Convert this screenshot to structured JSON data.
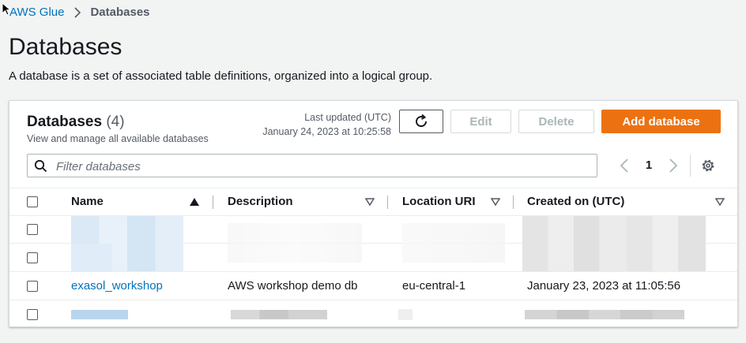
{
  "breadcrumb": {
    "parent": "AWS Glue",
    "current": "Databases"
  },
  "page": {
    "title": "Databases",
    "description": "A database is a set of associated table definitions, organized into a logical group."
  },
  "panel": {
    "title": "Databases",
    "count": "(4)",
    "subtitle": "View and manage all available databases",
    "last_updated_label": "Last updated (UTC)",
    "last_updated_value": "January 24, 2023 at 10:25:58",
    "buttons": {
      "edit": "Edit",
      "delete": "Delete",
      "add": "Add database"
    },
    "filter_placeholder": "Filter databases",
    "pagination": {
      "current_page": "1"
    }
  },
  "table": {
    "columns": [
      "Name",
      "Description",
      "Location URI",
      "Created on (UTC)"
    ],
    "sorted_column": "Name",
    "rows": [
      {
        "name": "",
        "description": "",
        "location": "",
        "created": "",
        "redacted": true
      },
      {
        "name": "",
        "description": "",
        "location": "",
        "created": "",
        "redacted": true
      },
      {
        "name": "exasol_workshop",
        "description": "AWS workshop demo db",
        "location": "eu-central-1",
        "created": "January 23, 2023 at 11:05:56",
        "redacted": false
      },
      {
        "name": "",
        "description": "",
        "location": "",
        "created": "",
        "redacted": true
      }
    ]
  },
  "colors": {
    "link": "#0073bb",
    "primary": "#ec7211",
    "background": "#f2f3f3"
  }
}
